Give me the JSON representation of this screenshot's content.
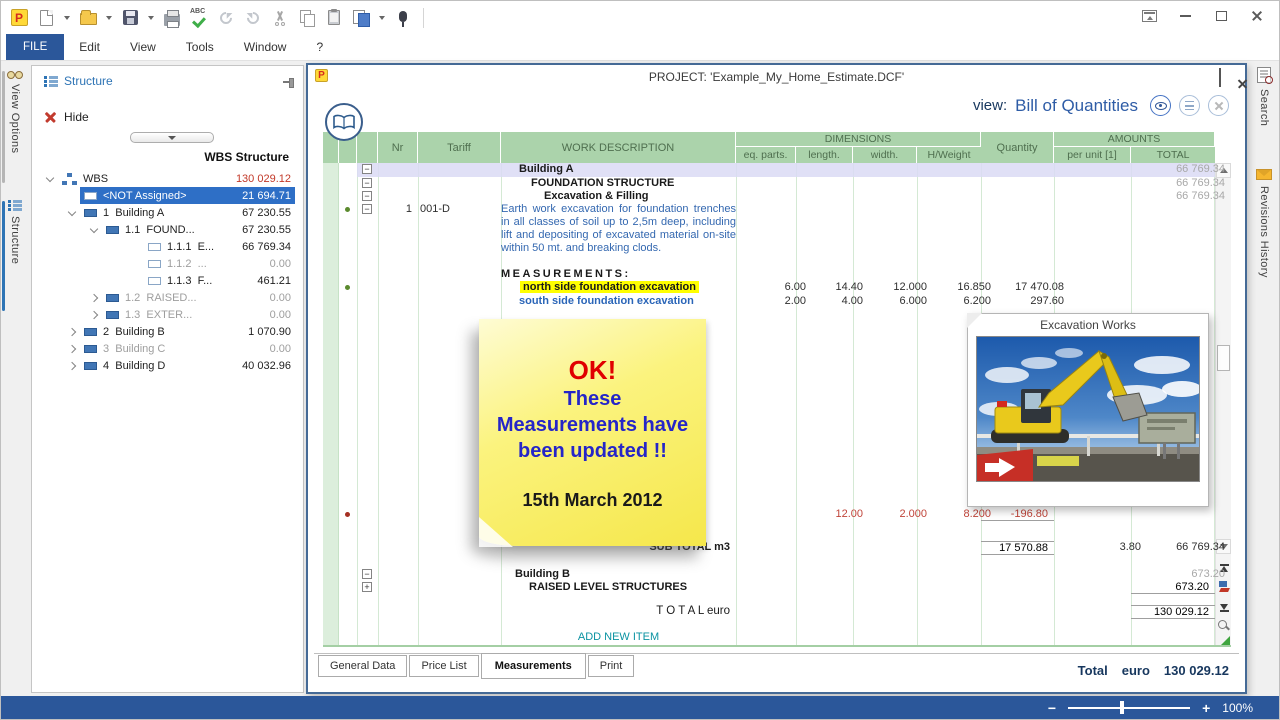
{
  "menu": {
    "items": [
      "FILE",
      "Edit",
      "View",
      "Tools",
      "Window",
      "?"
    ]
  },
  "toolbar": {
    "icons": [
      "primus-logo",
      "new-file",
      "open-folder",
      "save",
      "print",
      "spell-check",
      "undo",
      "redo",
      "cut",
      "copy",
      "paste",
      "export-pages",
      "record"
    ]
  },
  "sidebar": {
    "tabs": [
      {
        "label": "View Options"
      },
      {
        "label": "Structure"
      }
    ],
    "panel": {
      "title": "Structure",
      "hide_label": "Hide",
      "header": "WBS Structure"
    },
    "tree": [
      {
        "label": "WBS",
        "value": "130 029.12"
      },
      {
        "label": "<NOT Assigned>",
        "value": "21 694.71"
      },
      {
        "label": "1  Building A",
        "value": "67 230.55"
      },
      {
        "label": "1.1  FOUND...",
        "value": "67 230.55"
      },
      {
        "label": "1.1.1  E...",
        "value": "66 769.34"
      },
      {
        "label": "1.1.2  ...",
        "value": "0.00"
      },
      {
        "label": "1.1.3  F...",
        "value": "461.21"
      },
      {
        "label": "1.2  RAISED...",
        "value": "0.00"
      },
      {
        "label": "1.3  EXTER...",
        "value": "0.00"
      },
      {
        "label": "2  Building B",
        "value": "1 070.90"
      },
      {
        "label": "3  Building C",
        "value": "0.00"
      },
      {
        "label": "4  Building D",
        "value": "40 032.96"
      }
    ]
  },
  "project_window": {
    "title": "PROJECT: 'Example_My_Home_Estimate.DCF'",
    "view_label": "view:",
    "view_value": "Bill of Quantities",
    "table": {
      "headers": {
        "nr": "Nr",
        "tariff": "Tariff",
        "work_description": "WORK DESCRIPTION",
        "dimensions": "DIMENSIONS",
        "eq_parts": "eq. parts.",
        "length": "length.",
        "width": "width.",
        "h_weight": "H/Weight",
        "quantity": "Quantity",
        "amounts": "AMOUNTS",
        "per_unit": "per unit [1]",
        "total": "TOTAL"
      },
      "rows": [
        {
          "desc": "Building A",
          "total": "66 769.34"
        },
        {
          "desc": "FOUNDATION STRUCTURE",
          "total": "66 769.34"
        },
        {
          "desc": "Excavation & Filling",
          "total": "66 769.34"
        },
        {
          "nr": "1",
          "tariff": "001-D",
          "desc": "Earth work excavation for foundation trenches in all classes of soil up to 2,5m deep, including lift and depositing of excavated material on-site within 50 mt. and breaking clods."
        },
        {
          "desc": "MEASUREMENTS:"
        },
        {
          "desc": "north side foundation excavation",
          "eq_parts": "6.00",
          "length": "14.40",
          "width": "12.000",
          "h_weight": "16.850",
          "quantity": "17 470.08"
        },
        {
          "desc": "south side foundation excavation",
          "eq_parts": "2.00",
          "length": "4.00",
          "width": "6.000",
          "h_weight": "6.200",
          "quantity": "297.60"
        },
        {
          "length": "12.00",
          "width": "2.000",
          "h_weight": "8.200",
          "quantity": "-196.80"
        },
        {
          "desc": "SUB TOTAL m3",
          "quantity": "17 570.88",
          "per_unit": "3.80",
          "total": "66 769.34"
        },
        {
          "desc": "Building B",
          "total": "673.20"
        },
        {
          "desc": "RAISED LEVEL STRUCTURES",
          "total": "673.20"
        },
        {
          "desc": "T O T A L  euro",
          "total": "130 029.12"
        }
      ],
      "add_new_item": "ADD NEW ITEM"
    },
    "tabs": [
      {
        "label": "General Data"
      },
      {
        "label": "Price List"
      },
      {
        "label": "Measurements"
      },
      {
        "label": "Print"
      }
    ],
    "footer": {
      "label": "Total",
      "currency": "euro",
      "amount": "130 029.12"
    }
  },
  "right_panel": {
    "tabs": [
      {
        "label": "Search"
      },
      {
        "label": "Revisions History"
      }
    ]
  },
  "sticky_note": {
    "heading": "OK!",
    "line1": "These",
    "line2": "Measurements have",
    "line3": "been updated !!",
    "date": "15th March 2012"
  },
  "image_card": {
    "title": "Excavation Works"
  },
  "statusbar": {
    "zoom_out": "−",
    "zoom_in": "+",
    "zoom_level": "100%"
  }
}
